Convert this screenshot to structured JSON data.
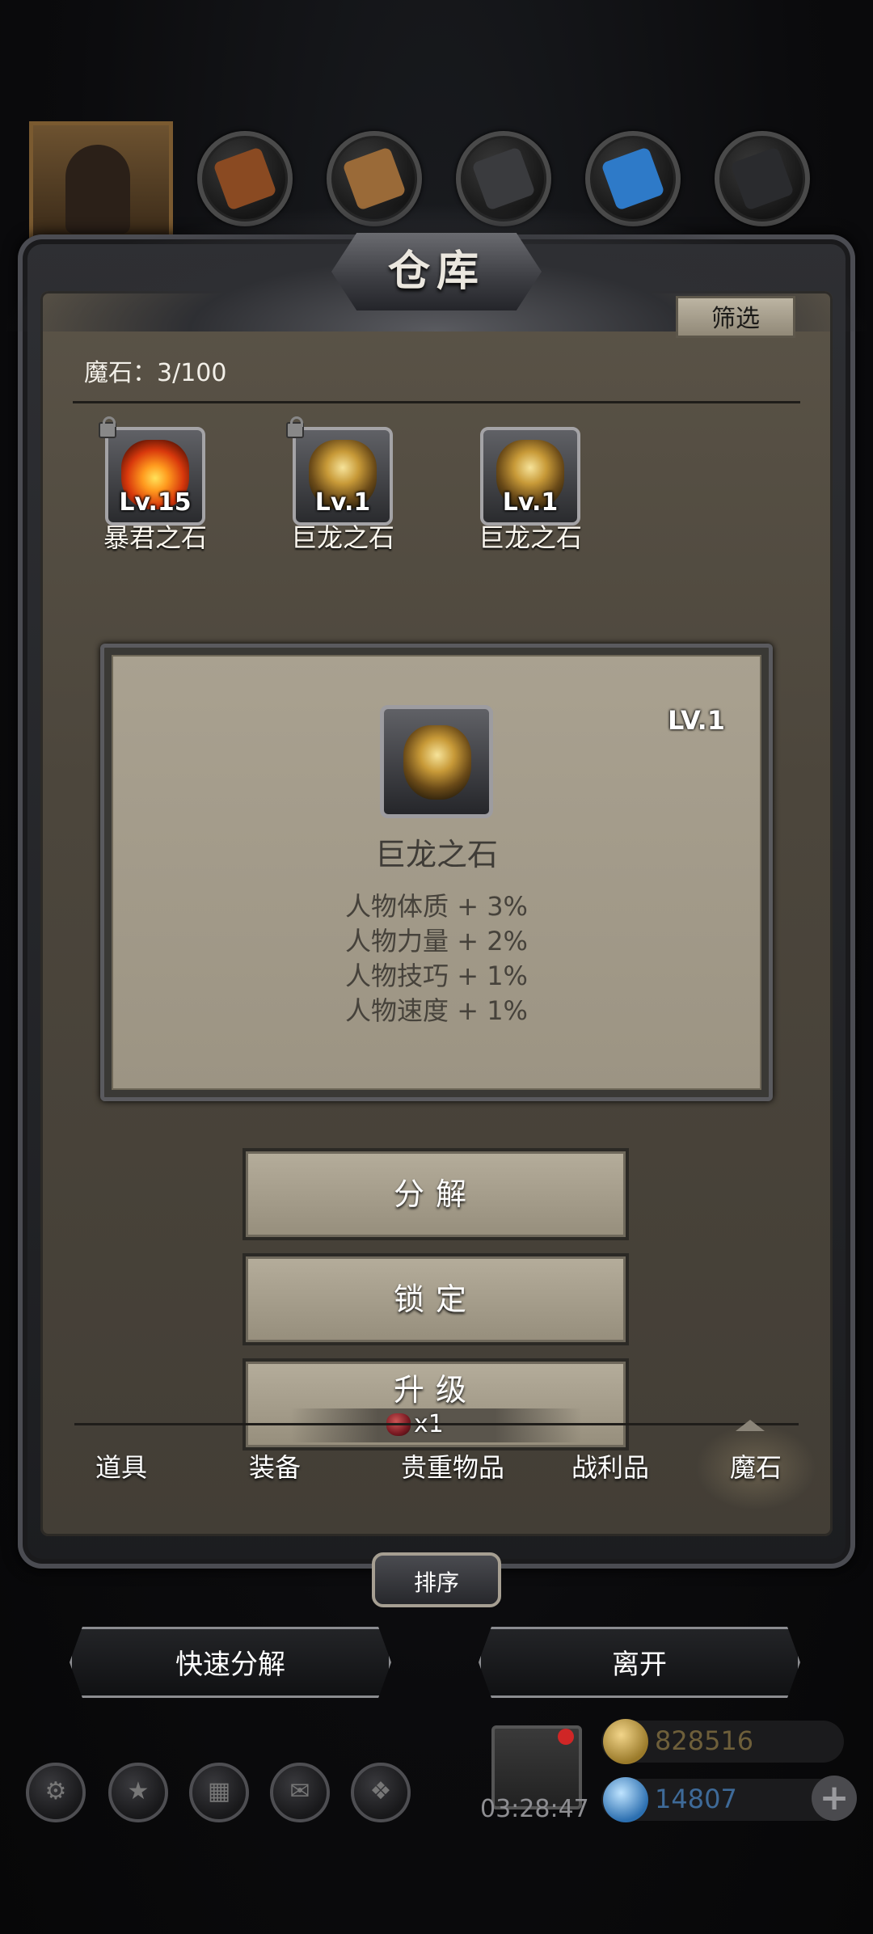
{
  "window": {
    "title": "仓库",
    "filter_label": "筛选"
  },
  "stone_count": "魔石：3/100",
  "items": [
    {
      "level": "Lv.15",
      "name": "暴君之石",
      "gem": "fire-stone-icon",
      "locked": true
    },
    {
      "level": "Lv.1",
      "name": "巨龙之石",
      "gem": "dragon-stone-icon",
      "locked": true
    },
    {
      "level": "Lv.1",
      "name": "巨龙之石",
      "gem": "dragon-stone-icon",
      "locked": false
    }
  ],
  "detail": {
    "level": "LV.1",
    "name": "巨龙之石",
    "stats": [
      "人物体质 + 3%",
      "人物力量 + 2%",
      "人物技巧 + 1%",
      "人物速度 + 1%"
    ]
  },
  "actions": {
    "decompose": "分解",
    "lock": "锁定",
    "upgrade": "升级",
    "upgrade_cost": "x1"
  },
  "tabs": [
    "道具",
    "装备",
    "贵重物品",
    "战利品",
    "魔石"
  ],
  "active_tab": "魔石",
  "sort_label": "排序",
  "bottom_buttons": {
    "quick_decompose": "快速分解",
    "leave": "离开"
  },
  "hud": {
    "timer": "03:28:47",
    "gold": "828516",
    "gems": "14807"
  },
  "colors": {
    "panel": "#4c463c",
    "card": "#a9a190",
    "button": "#b5ad9b"
  }
}
